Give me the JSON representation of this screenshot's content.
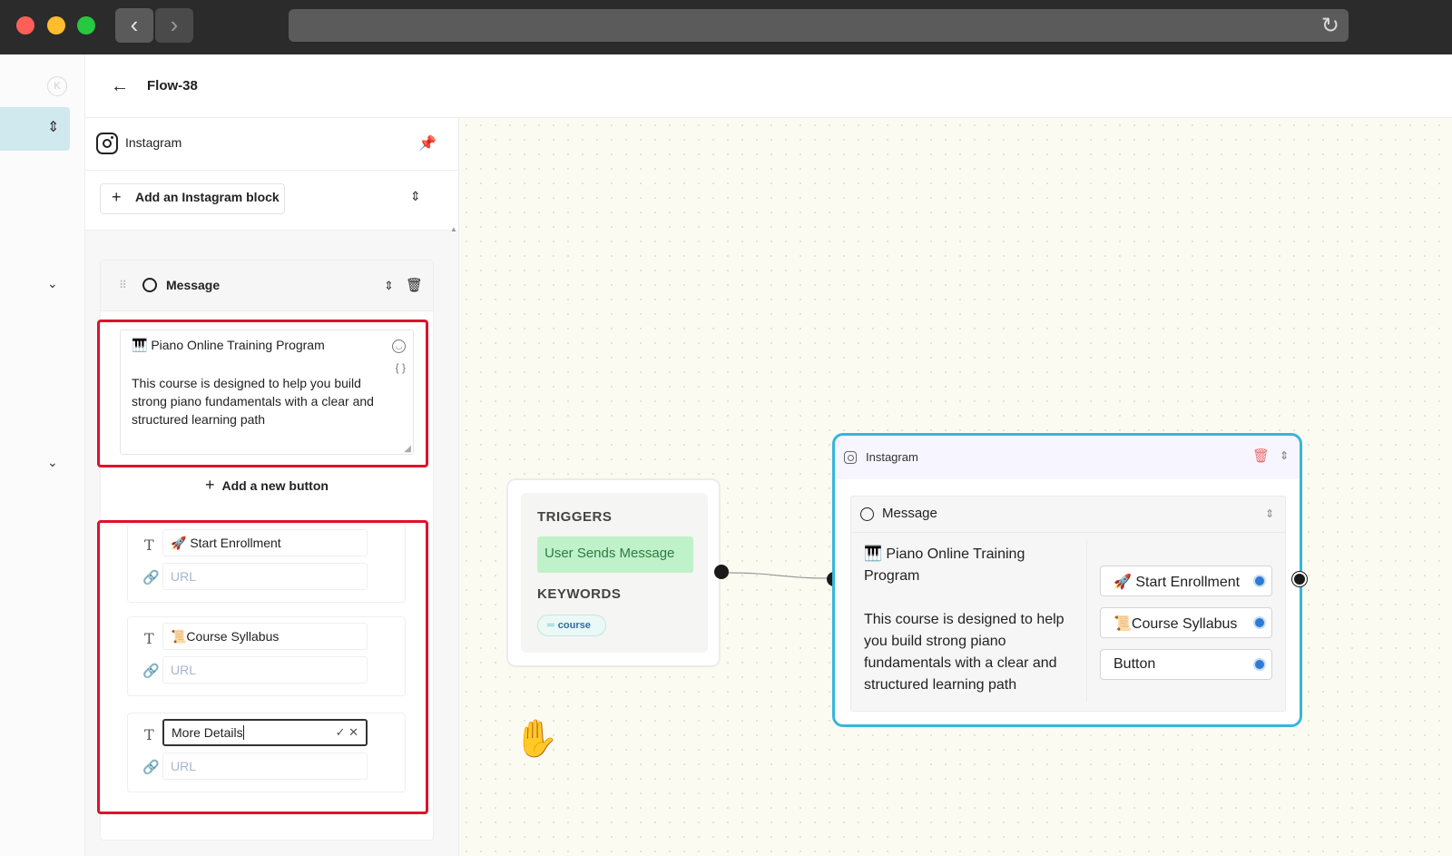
{
  "browser": {
    "back_glyph": "‹",
    "forward_glyph": "›",
    "reload_glyph": "↻"
  },
  "rail": {
    "k_label": "K"
  },
  "header": {
    "title": "Flow-38"
  },
  "panel": {
    "title": "Instagram",
    "add_block_label": "Add an Instagram block",
    "message_block": {
      "title": "Message",
      "text_title": "🎹 Piano Online Training Program",
      "text_body": "This course is designed to help you build strong piano fundamentals with a clear and structured learning path",
      "add_button_label": "Add a new button",
      "buttons": [
        {
          "label": "🚀 Start Enrollment",
          "url_placeholder": "URL"
        },
        {
          "label": "📜Course Syllabus",
          "url_placeholder": "URL"
        },
        {
          "label": "More Details",
          "url_placeholder": "URL"
        }
      ]
    }
  },
  "canvas": {
    "trigger_node": {
      "triggers_label": "TRIGGERS",
      "trigger": "User Sends Message",
      "keywords_label": "KEYWORDS",
      "keyword": "course"
    },
    "instagram_node": {
      "title": "Instagram",
      "message_label": "Message",
      "text_title": "🎹 Piano Online Training Program",
      "text_body": "This course is designed to help you build strong piano fundamentals with a clear and structured learning path",
      "buttons": [
        "🚀 Start Enrollment",
        "📜Course Syllabus",
        "Button"
      ]
    }
  },
  "colors": {
    "accent": "#37b6dc",
    "highlight": "#e0112b",
    "trigger_chip": "#bff2c8",
    "port": "#2e7bd6"
  },
  "icons": {
    "pin": "pin-icon",
    "trash": "trash-icon",
    "hand": "hand-cursor-icon"
  }
}
